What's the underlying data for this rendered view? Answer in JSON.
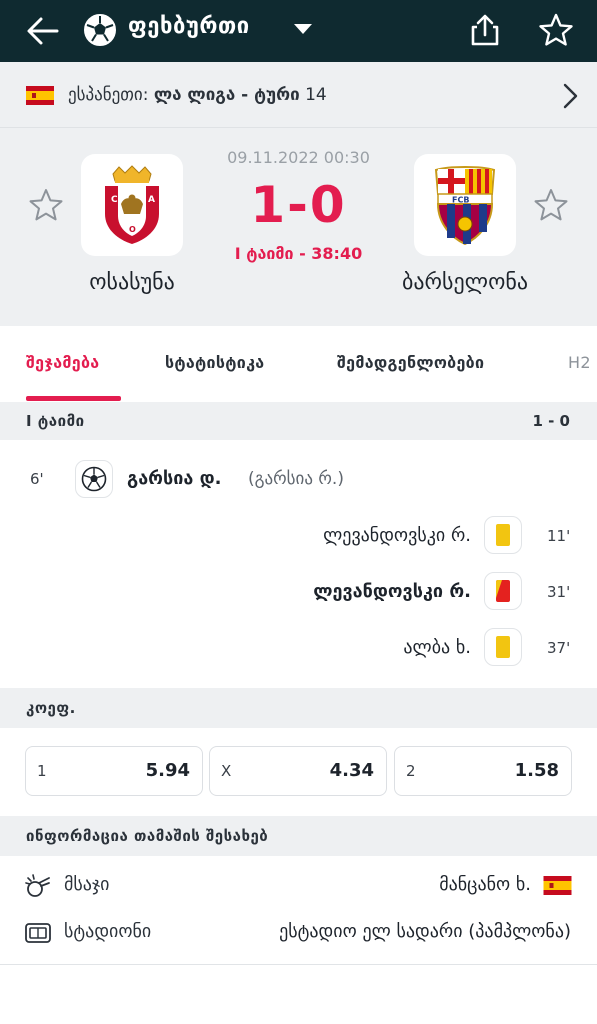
{
  "topbar": {
    "title": "ფეხბურთი",
    "back_icon": "arrow-left-icon",
    "sport_icon": "soccer-ball-icon",
    "share_icon": "share-icon",
    "favorite_icon": "star-outline-icon"
  },
  "league": {
    "country": "ესპანეთი:",
    "name": "ლა ლიგა - ტური",
    "round": "14",
    "flag": "spain-flag-icon"
  },
  "match": {
    "datetime": "09.11.2022 00:30",
    "score": "1-0",
    "status": "I ტაიმი - 38:40",
    "home": {
      "name": "ოსასუნა",
      "logo": "osasuna-crest-icon"
    },
    "away": {
      "name": "ბარსელონა",
      "logo": "fc-barcelona-crest-icon"
    }
  },
  "tabs": [
    {
      "label": "შეჯამება",
      "active": true
    },
    {
      "label": "სტატისტიკა",
      "active": false
    },
    {
      "label": "შემადგენლობები",
      "active": false
    },
    {
      "label": "H2",
      "active": false
    }
  ],
  "half": {
    "label": "I ტაიმი",
    "score": "1 - 0"
  },
  "events": [
    {
      "minute": "6'",
      "side": "home",
      "type": "goal",
      "player": "გარსია დ.",
      "assist": "(გარსია რ.)"
    },
    {
      "minute": "11'",
      "side": "away",
      "type": "yellow-card",
      "player": "ლევანდოვსკი რ."
    },
    {
      "minute": "31'",
      "side": "away",
      "type": "second-yellow-red-card",
      "player": "ლევანდოვსკი რ."
    },
    {
      "minute": "37'",
      "side": "away",
      "type": "yellow-card",
      "player": "ალბა ხ."
    }
  ],
  "odds": {
    "label": "კოეფ.",
    "items": [
      {
        "key": "1",
        "value": "5.94"
      },
      {
        "key": "X",
        "value": "4.34"
      },
      {
        "key": "2",
        "value": "1.58"
      }
    ]
  },
  "info": {
    "label": "ინფორმაცია თამაშის შესახებ",
    "referee": {
      "key": "მსაჯი",
      "value": "მანცანო ხ.",
      "icon": "whistle-icon",
      "flag": "spain-flag-icon"
    },
    "stadium": {
      "key": "სტადიონი",
      "value": "ესტადიო ელ სადარი (პამპლონა)",
      "icon": "stadium-icon"
    }
  },
  "colors": {
    "topbar_bg": "#0f2a30",
    "accent_red": "#e31d4f",
    "section_bg": "#eef0f2",
    "yellow_card": "#f2c511",
    "red_card": "#e4221f"
  }
}
